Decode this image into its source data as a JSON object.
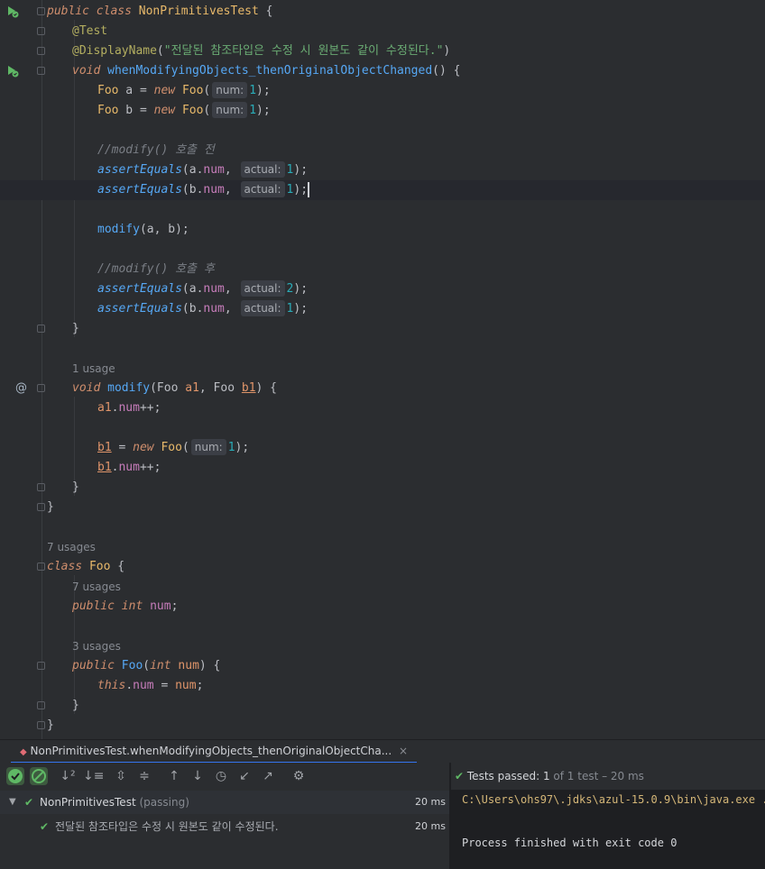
{
  "editor": {
    "line1": {
      "public": "public",
      "class": "class",
      "name": "NonPrimitivesTest",
      "brace": " {"
    },
    "line2": {
      "annotation": "@Test"
    },
    "line3": {
      "annotation": "@DisplayName",
      "open": "(",
      "string": "\"전달된 참조타입은 수정 시 원본도 같이 수정된다.\"",
      "close": ")"
    },
    "line4": {
      "void": "void",
      "method": "whenModifyingObjects_thenOriginalObjectChanged",
      "rest": "() {"
    },
    "line5": {
      "type": "Foo",
      "var": " a = ",
      "new": "new",
      "ctor": "Foo",
      "open": "(",
      "hint": "num:",
      "num": "1",
      "close": ");"
    },
    "line6": {
      "type": "Foo",
      "var": " b = ",
      "new": "new",
      "ctor": "Foo",
      "open": "(",
      "hint": "num:",
      "num": "1",
      "close": ");"
    },
    "line8": {
      "comment": "//modify() 호출 전"
    },
    "line9": {
      "fn": "assertEquals",
      "args": "(a.",
      "field": "num",
      "comma": ",",
      "hint": "actual:",
      "num": "1",
      "close": ");"
    },
    "line10": {
      "fn": "assertEquals",
      "args": "(b.",
      "field": "num",
      "comma": ",",
      "hint": "actual:",
      "num": "1",
      "close": ");"
    },
    "line12": {
      "fn": "modify",
      "args": "(a, b);"
    },
    "line14": {
      "comment": "//modify() 호출 후"
    },
    "line15": {
      "fn": "assertEquals",
      "args": "(a.",
      "field": "num",
      "comma": ",",
      "hint": "actual:",
      "num": "2",
      "close": ");"
    },
    "line16": {
      "fn": "assertEquals",
      "args": "(b.",
      "field": "num",
      "comma": ",",
      "hint": "actual:",
      "num": "1",
      "close": ");"
    },
    "line17": {
      "brace": "}"
    },
    "usage1": "1 usage",
    "line19": {
      "void": "void",
      "fn": "modify",
      "p1t": "(Foo ",
      "p1": "a1",
      "sep": ", Foo ",
      "p2": "b1",
      "end": ") {"
    },
    "line20": {
      "p": "a1",
      "dot": ".",
      "field": "num",
      "op": "++;"
    },
    "line22": {
      "p": "b1",
      "eq": " = ",
      "new": "new",
      "ctor": "Foo",
      "open": "(",
      "hint": "num:",
      "num": "1",
      "close": ");"
    },
    "line23": {
      "p": "b1",
      "dot": ".",
      "field": "num",
      "op": "++;"
    },
    "line24": {
      "brace": "}"
    },
    "line25": {
      "brace": "}"
    },
    "usage2": "7 usages",
    "line27": {
      "class": "class",
      "name": "Foo",
      "brace": " {"
    },
    "usage3": "7 usages",
    "line29": {
      "public": "public",
      "int": "int",
      "field": "num",
      "semi": ";"
    },
    "usage4": "3 usages",
    "line31": {
      "public": "public",
      "ctor": "Foo",
      "open": "(",
      "int": "int",
      "param": "num",
      "close": ") {"
    },
    "line32": {
      "this": "this",
      "dot": ".",
      "field": "num",
      "eq": " = ",
      "param": "num",
      "semi": ";"
    },
    "line33": {
      "brace": "}"
    },
    "line34": {
      "brace": "}"
    },
    "gutter_at": "@"
  },
  "run": {
    "tab_label": "NonPrimitivesTest.whenModifyingObjects_thenOriginalObjectCha...",
    "tab_close": "×",
    "status_label": "Tests passed:",
    "status_count": "1",
    "status_rest": "of 1 test – 20 ms",
    "tree": [
      {
        "name": "NonPrimitivesTest",
        "state": "(passing)",
        "duration": "20 ms"
      },
      {
        "name": "전달된 참조타입은 수정 시 원본도 같이 수정된다.",
        "duration": "20 ms"
      }
    ],
    "console": {
      "cmd": "C:\\Users\\ohs97\\.jdks\\azul-15.0.9\\bin\\java.exe ...",
      "exit": "Process finished with exit code 0"
    }
  },
  "colors": {
    "accent": "#3574f0",
    "pass": "#5fb865",
    "background": "#2b2d30"
  },
  "icons": [
    "run-test-icon",
    "fold-icon",
    "check-icon",
    "stop-icon",
    "sort-alpha-icon",
    "sort-duration-icon",
    "expand-all-icon",
    "collapse-all-icon",
    "up-arrow-icon",
    "down-arrow-icon",
    "history-icon",
    "import-icon",
    "export-icon",
    "settings-icon",
    "close-icon",
    "chevron-down-icon"
  ]
}
